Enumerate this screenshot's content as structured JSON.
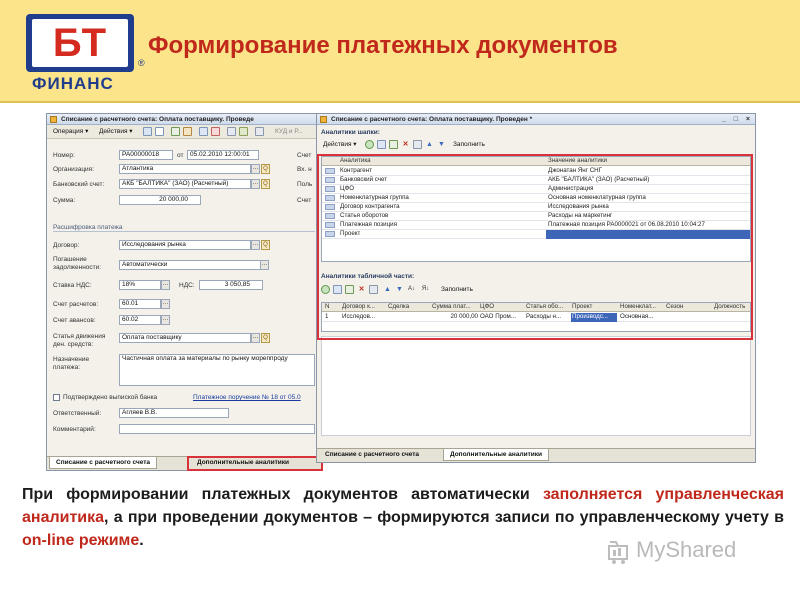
{
  "header": {
    "logo_letters": "БТ",
    "logo_word": "ФИНАНС",
    "logo_reg": "®",
    "title": "Формирование платежных документов"
  },
  "win1": {
    "title": "Списание с расчетного счета: Оплата поставщику. Проведе",
    "toolbar": {
      "operation": "Операция ▾",
      "actions": "Действия ▾",
      "kud": "КУД и Р..."
    },
    "fields": {
      "number_label": "Номер:",
      "number_value": "РА00000018",
      "from_label": "от",
      "date_value": "05.02.2010 12:00:01",
      "org_label": "Организация:",
      "org_value": "Атлантика",
      "bank_label": "Банковский счет:",
      "bank_value": "АКБ \"БАЛТИКА\" (ЗАО) (Расчетный)",
      "sum_label": "Сумма:",
      "sum_value": "20 000,00",
      "right_labels": [
        "Счет",
        "Вх. н",
        "Поль",
        "Счет"
      ]
    },
    "section": "Расшифровка платежа",
    "payment": {
      "contract_label": "Договор:",
      "contract_value": "Исследования рынка",
      "repay_label_1": "Погашение",
      "repay_label_2": "задолженности:",
      "repay_value": "Автоматически",
      "vat_rate_label": "Ставка НДС:",
      "vat_rate_value": "18%",
      "vat_label": "НДС:",
      "vat_value": "3 050,85",
      "acc_label": "Счет расчетов:",
      "acc_value": "60.01",
      "adv_label": "Счет авансов:",
      "adv_value": "60.02",
      "flow_label_1": "Статья движения",
      "flow_label_2": "ден. средств:",
      "flow_value": "Оплата поставщику",
      "purpose_label_1": "Назначение",
      "purpose_label_2": "платежа:",
      "purpose_value": "Частичная оплата за материалы по рынку мореппроду"
    },
    "confirmed_label": "Подтверждено выпиской банка",
    "payment_order_link": "Платежное поручение № 18 от 05.0",
    "responsible_label": "Ответственный:",
    "responsible_value": "Агляев В.В.",
    "comment_label": "Комментарий:",
    "tabs": [
      "Списание с расчетного счета",
      "Дополнительные аналитики"
    ]
  },
  "win2": {
    "title": "Списание с расчетного счета: Оплата поставщику. Проведен *",
    "header_panel": "Аналитики шапки:",
    "toolbar_actions": "Действия ▾",
    "fill_label": "Заполнить",
    "head_columns": [
      "Аналитика",
      "Значение аналитики"
    ],
    "head_rows": [
      [
        "Контрагент",
        "Джонатан Янг СНГ"
      ],
      [
        "Банковский счет",
        "АКБ \"БАЛТИКА\" (ЗАО) (Расчетный)"
      ],
      [
        "ЦФО",
        "Администрация"
      ],
      [
        "Номенклатурная группа",
        "Основная номенклатурная группа"
      ],
      [
        "Договор контрагента",
        "Исследования рынка"
      ],
      [
        "Статья оборотов",
        "Расходы на маркетинг"
      ],
      [
        "Платежная позиция",
        "Платежная позиция РА0000021 от 06.08.2010 10:04:27"
      ],
      [
        "Проект",
        ""
      ]
    ],
    "table_panel": "Аналитики табличной части:",
    "table_columns": [
      "N",
      "Договор к...",
      "Сделка",
      "Сумма плат...",
      "ЦФО",
      "Статья обо...",
      "Проект",
      "Номенклат...",
      "Сезон",
      "Должность"
    ],
    "table_rows": [
      [
        "1",
        "Исследов...",
        "",
        "20 000,00",
        "ОАО Пром...",
        "Расходы н...",
        "Производс...",
        "Основная...",
        "",
        ""
      ]
    ],
    "tabs": [
      "Списание с расчетного счета",
      "Дополнительные аналитики"
    ]
  },
  "text": {
    "p1": "При формировании платежных документов автоматически ",
    "p1_red": "заполняется управленческая аналитика",
    "p2": ", а при проведении документов – формируются записи по управленческому учету в ",
    "p2_red": "on-line режиме",
    "p3": "."
  },
  "watermark": "MyShared",
  "colors": {
    "title_red": "#c0281c",
    "header_bg": "#fbe48a",
    "logo_blue": "#1f3d8c",
    "highlight_red": "#d9323a",
    "selection_blue": "#3d66b8"
  }
}
